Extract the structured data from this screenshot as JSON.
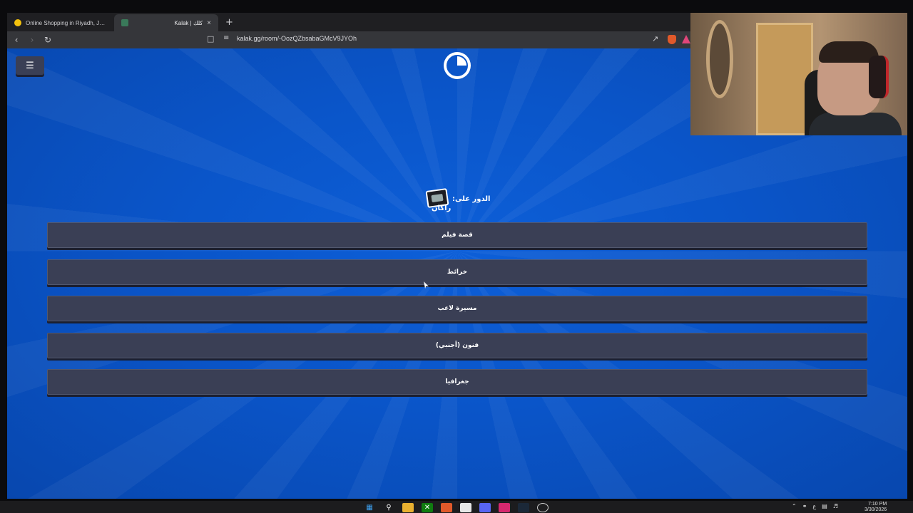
{
  "browser": {
    "tabs": [
      {
        "title": "Online Shopping in Riyadh, Jeddah a",
        "active": false
      },
      {
        "title": "Kalak | كلك",
        "active": true
      }
    ],
    "new_tab_label": "+",
    "close_label": "×",
    "url": "kalak.gg/room/-OozQZbsabaGMcV9JYOh"
  },
  "game": {
    "menu_icon": "☰",
    "turn_label": "الدور على:",
    "turn_player": "راكان",
    "options": [
      {
        "label": "قصة فيلم"
      },
      {
        "label": "خرائط"
      },
      {
        "label": "مسيرة لاعب"
      },
      {
        "label": "فنون (أجنبي)"
      },
      {
        "label": "جغرافيا"
      }
    ]
  },
  "taskbar": {
    "time": "7:10 PM",
    "date": "3/30/2026",
    "lang": "ع"
  },
  "colors": {
    "page_bg": "#0a55c9",
    "button_bg": "#3a3f55",
    "accent_red": "#c0262a"
  }
}
